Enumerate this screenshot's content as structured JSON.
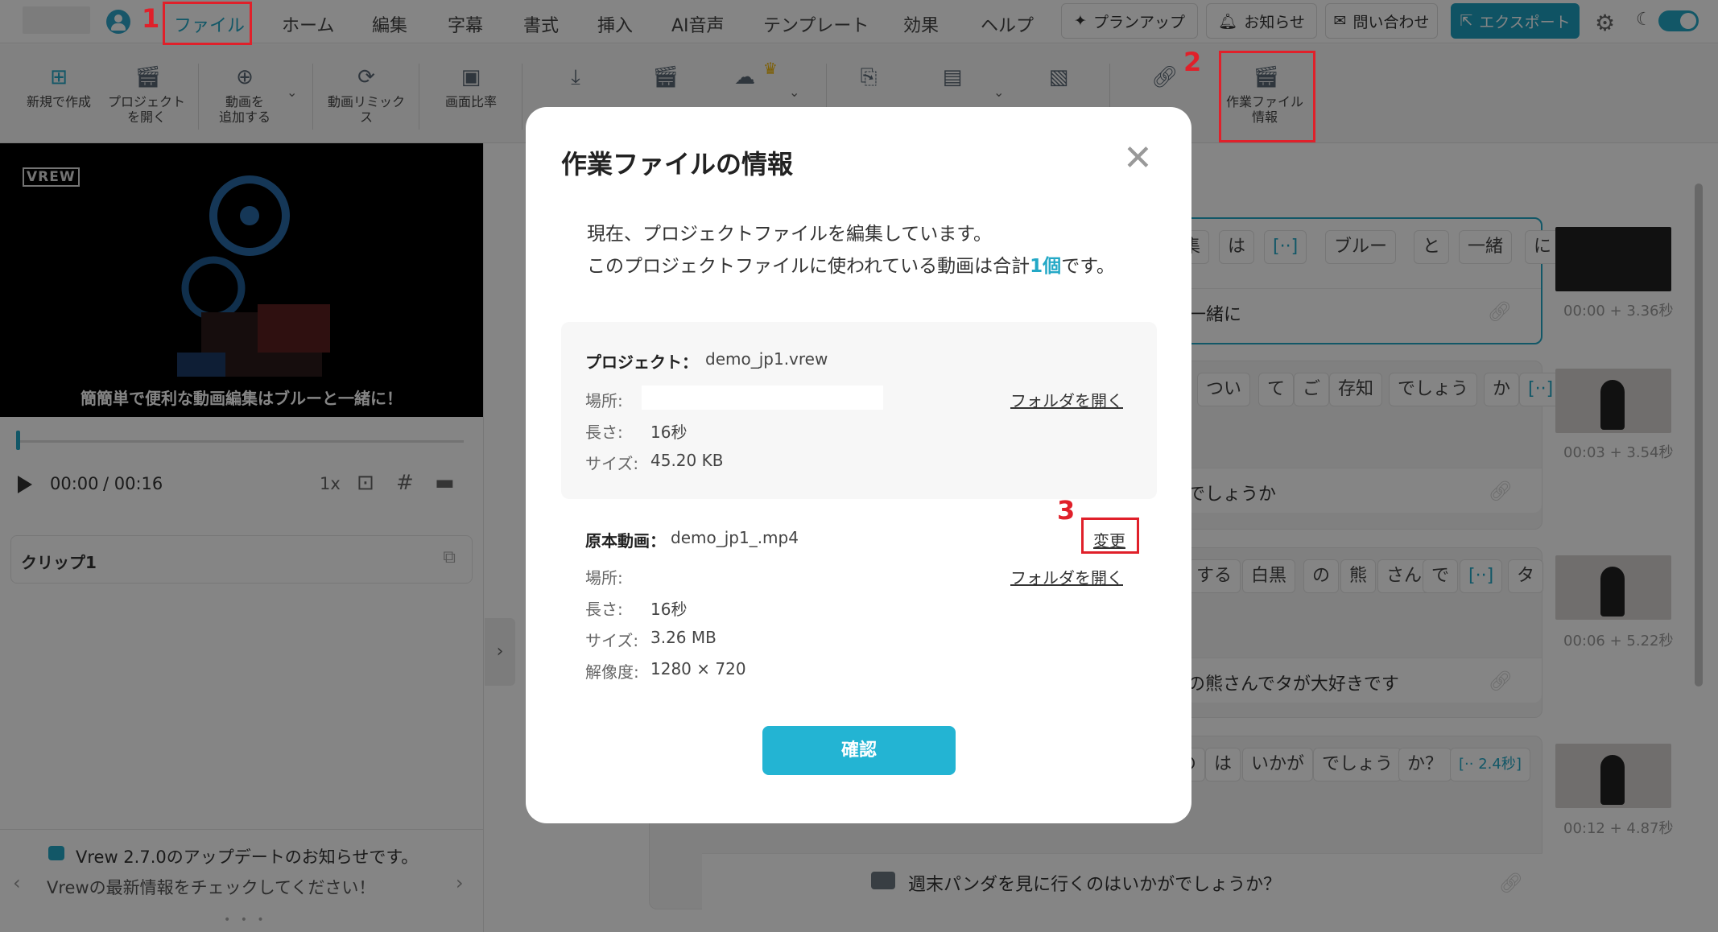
{
  "menu": {
    "items": [
      "ファイル",
      "ホーム",
      "編集",
      "字幕",
      "書式",
      "挿入",
      "AI音声",
      "テンプレート",
      "効果",
      "ヘルプ"
    ],
    "active": "ファイル"
  },
  "top_buttons": {
    "plan_up": "プランアップ",
    "news": "お知らせ",
    "contact": "問い合わせ",
    "export": "エクスポート"
  },
  "toolbar": {
    "new_project": "新規で作成",
    "open_project_l1": "プロジェクト",
    "open_project_l2": "を開く",
    "add_video_l1": "動画を",
    "add_video_l2": "追加する",
    "remix_l1": "動画リミック",
    "remix_l2": "ス",
    "aspect_ratio": "画面比率",
    "work_file_info_l1": "作業ファイル",
    "work_file_info_l2": "情報"
  },
  "annotations": {
    "n1": "1",
    "n2": "2",
    "n3": "3"
  },
  "player": {
    "logo": "VREW",
    "caption": "簡簡単で便利な動画編集はブルーと一緒に！",
    "time_current": "00:00",
    "time_total": "/ 00:16",
    "speed": "1x"
  },
  "clip": {
    "title": "クリップ1"
  },
  "update_notice": {
    "line1": "Vrew 2.7.0のアップデートのお知らせです。",
    "line2": "Vrewの最新情報をチェックしてください！",
    "dots": "• • •"
  },
  "editor": {
    "row1_words": [
      "集",
      "は",
      "[··]",
      "ブルー",
      "と",
      "一緒",
      "に"
    ],
    "row1_text": "一緒に",
    "row2_words": [
      "つい",
      "て",
      "ご",
      "存知",
      "でしょう",
      "か",
      "[··]"
    ],
    "row2_text": "でしょうか",
    "row3_words": [
      "する",
      "白黒",
      "の",
      "熊",
      "さん",
      "で",
      "[··]",
      "タ"
    ],
    "row3_text": "の熊さんでタが大好きです",
    "row4_words": [
      "の",
      "は",
      "いかが",
      "でしょう",
      "か？",
      "[·· 2.4秒]"
    ],
    "last_text": "週末パンダを見に行くのはいかがでしょうか？",
    "thumb_times": [
      "00:00 + 3.36秒",
      "00:03 + 3.54秒",
      "00:06 + 5.22秒",
      "00:12 + 4.87秒"
    ]
  },
  "modal": {
    "title": "作業ファイルの情報",
    "desc_line1": "現在、プロジェクトファイルを編集しています。",
    "desc_line2_a": "このプロジェクトファイルに使われている動画は合計",
    "desc_line2_count": "1個",
    "desc_line2_b": "です。",
    "project": {
      "label": "プロジェクト：",
      "name": "demo_jp1.vrew",
      "location_label": "場所:",
      "open_folder": "フォルダを開く",
      "length_label": "長さ:",
      "length": "16秒",
      "size_label": "サイズ:",
      "size": "45.20 KB"
    },
    "original": {
      "label": "原本動画：",
      "name": "demo_jp1_.mp4",
      "change": "変更",
      "location_label": "場所:",
      "open_folder": "フォルダを開く",
      "length_label": "長さ:",
      "length": "16秒",
      "size_label": "サイズ:",
      "size": "3.26 MB",
      "resolution_label": "解像度:",
      "resolution": "1280 × 720"
    },
    "confirm": "確認"
  },
  "colors": {
    "accent": "#23a8c6",
    "export": "#1e9fc0",
    "annotation_red": "#e0202a",
    "overlay": "rgba(0,0,0,0.48)"
  },
  "icons": [
    "user-icon",
    "sparkle-icon",
    "bell-icon",
    "mail-icon",
    "export-icon",
    "gear-icon",
    "moon-icon",
    "new-project-icon",
    "clapper-icon",
    "add-video-icon",
    "remix-icon",
    "aspect-ratio-icon",
    "download-icon",
    "cloud-icon",
    "crown-icon",
    "link-icon",
    "info-clapper-icon",
    "play-icon",
    "capture-icon",
    "grid-icon",
    "subtitle-icon",
    "external-link-icon",
    "close-icon"
  ]
}
